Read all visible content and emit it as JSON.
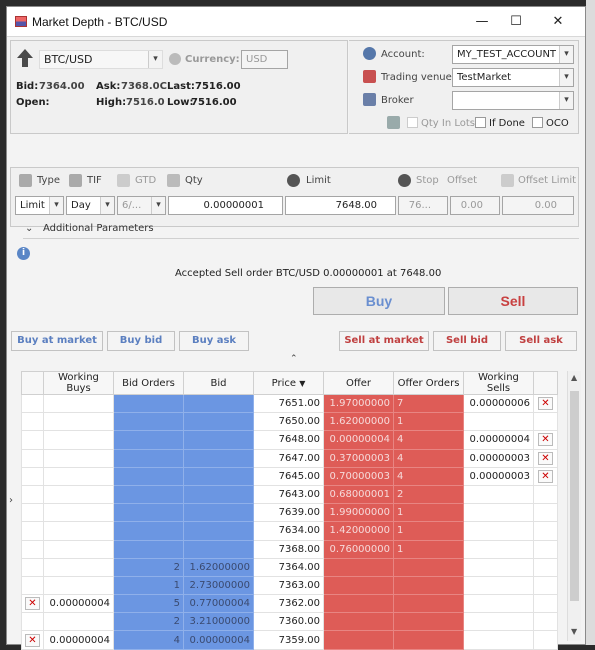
{
  "window": {
    "title": "Market Depth - BTC/USD",
    "minimize": "—",
    "maximize": "☐",
    "close": "✕"
  },
  "instrument": {
    "symbol": "BTC/USD",
    "currency_label": "Currency:",
    "currency_value": "USD"
  },
  "quote": {
    "bid_label": "Bid:",
    "bid": "7364.00",
    "ask_label": "Ask:",
    "ask": "7368.0C",
    "last_label": "Last:",
    "last": "7516.00",
    "open_label": "Open:",
    "high_label": "High:",
    "high": "7516.0",
    "low_label": "Low:",
    "low": "7516.00"
  },
  "account": {
    "account_label": "Account:",
    "account_value": "MY_TEST_ACCOUNT",
    "venue_label": "Trading venue:",
    "venue_value": "TestMarket",
    "broker_label": "Broker",
    "broker_value": "",
    "qty_in_lots": "Qty In Lots",
    "if_done": "If Done",
    "oco": "OCO"
  },
  "order": {
    "type_label": "Type",
    "tif_label": "TIF",
    "gtd_label": "GTD",
    "qty_label": "Qty",
    "limit_label": "Limit",
    "stop_label": "Stop",
    "offset_label": "Offset",
    "offset_limit_label": "Offset Limit",
    "type_value": "Limit",
    "tif_value": "Day",
    "gtd_value": "6/...",
    "qty_value": "0.00000001",
    "limit_value": "7648.00",
    "stop_value": "76...",
    "offset_value": "0.00",
    "offset_limit_value": "0.00",
    "additional_params": "Additional Parameters",
    "status": "Accepted Sell order BTC/USD 0.00000001 at 7648.00",
    "buy": "Buy",
    "sell": "Sell"
  },
  "quick_buttons": {
    "buy_market": "Buy at market",
    "buy_bid": "Buy bid",
    "buy_ask": "Buy ask",
    "sell_market": "Sell at market",
    "sell_bid": "Sell bid",
    "sell_ask": "Sell ask"
  },
  "grid": {
    "headers": [
      "Working Buys",
      "Bid Orders",
      "Bid",
      "Price",
      "Offer",
      "Offer Orders",
      "Working Sells"
    ],
    "rows": [
      {
        "wb": "",
        "bo": "",
        "bid": "",
        "price": "7651.00",
        "offer": "1.97000000",
        "oo": "7",
        "ws": "0.00000006",
        "xl": false,
        "xr": true
      },
      {
        "wb": "",
        "bo": "",
        "bid": "",
        "price": "7650.00",
        "offer": "1.62000000",
        "oo": "1",
        "ws": "",
        "xl": false,
        "xr": false
      },
      {
        "wb": "",
        "bo": "",
        "bid": "",
        "price": "7648.00",
        "offer": "0.00000004",
        "oo": "4",
        "ws": "0.00000004",
        "xl": false,
        "xr": true
      },
      {
        "wb": "",
        "bo": "",
        "bid": "",
        "price": "7647.00",
        "offer": "0.37000003",
        "oo": "4",
        "ws": "0.00000003",
        "xl": false,
        "xr": true
      },
      {
        "wb": "",
        "bo": "",
        "bid": "",
        "price": "7645.00",
        "offer": "0.70000003",
        "oo": "4",
        "ws": "0.00000003",
        "xl": false,
        "xr": true
      },
      {
        "wb": "",
        "bo": "",
        "bid": "",
        "price": "7643.00",
        "offer": "0.68000001",
        "oo": "2",
        "ws": "",
        "xl": false,
        "xr": false
      },
      {
        "wb": "",
        "bo": "",
        "bid": "",
        "price": "7639.00",
        "offer": "1.99000000",
        "oo": "1",
        "ws": "",
        "xl": false,
        "xr": false
      },
      {
        "wb": "",
        "bo": "",
        "bid": "",
        "price": "7634.00",
        "offer": "1.42000000",
        "oo": "1",
        "ws": "",
        "xl": false,
        "xr": false
      },
      {
        "wb": "",
        "bo": "",
        "bid": "",
        "price": "7368.00",
        "offer": "0.76000000",
        "oo": "1",
        "ws": "",
        "xl": false,
        "xr": false
      },
      {
        "wb": "",
        "bo": "2",
        "bid": "1.62000000",
        "price": "7364.00",
        "offer": "",
        "oo": "",
        "ws": "",
        "xl": false,
        "xr": false
      },
      {
        "wb": "",
        "bo": "1",
        "bid": "2.73000000",
        "price": "7363.00",
        "offer": "",
        "oo": "",
        "ws": "",
        "xl": false,
        "xr": false
      },
      {
        "wb": "0.00000004",
        "bo": "5",
        "bid": "0.77000004",
        "price": "7362.00",
        "offer": "",
        "oo": "",
        "ws": "",
        "xl": true,
        "xr": false
      },
      {
        "wb": "",
        "bo": "2",
        "bid": "3.21000000",
        "price": "7360.00",
        "offer": "",
        "oo": "",
        "ws": "",
        "xl": false,
        "xr": false
      },
      {
        "wb": "0.00000004",
        "bo": "4",
        "bid": "0.00000004",
        "price": "7359.00",
        "offer": "",
        "oo": "",
        "ws": "",
        "xl": true,
        "xr": false
      }
    ]
  },
  "colors": {
    "bid": "#6b96e2",
    "offer": "#de5c57",
    "bid_text": "#c00000"
  }
}
